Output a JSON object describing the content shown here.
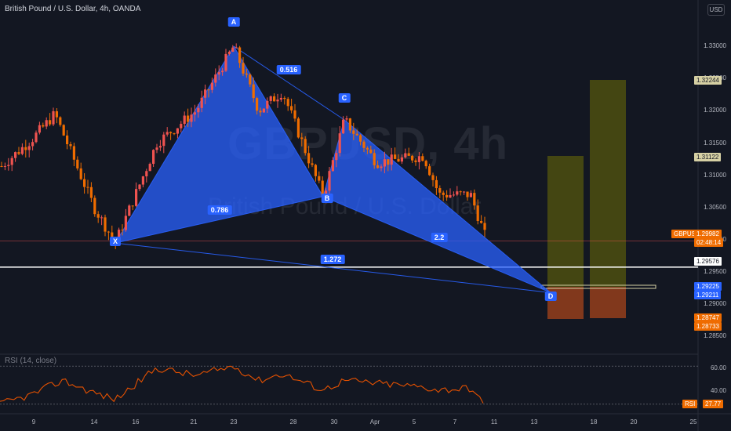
{
  "header": {
    "title": "British Pound / U.S. Dollar, 4h, OANDA",
    "currency_button": "USD"
  },
  "watermark": {
    "symbol": "GBPUSD, 4h",
    "description": "British Pound / U.S. Dollar"
  },
  "price_axis": {
    "ticks": [
      "1.33000",
      "1.32500",
      "1.32000",
      "1.31500",
      "1.31000",
      "1.30500",
      "1.30000",
      "1.29500",
      "1.29000",
      "1.28500"
    ],
    "tags": {
      "target2": "1.32244",
      "target1": "1.31122",
      "symbol_label": "GBPUSD",
      "last_price": "1.29982",
      "countdown": "02:48:14",
      "hline": "1.29576",
      "entry_a": "1.29225",
      "entry_b": "1.29211",
      "stop_a": "1.28747",
      "stop_b": "1.28733"
    }
  },
  "time_axis": {
    "labels": [
      "9",
      "14",
      "16",
      "21",
      "23",
      "28",
      "30",
      "Apr",
      "5",
      "7",
      "11",
      "13",
      "18",
      "20",
      "25"
    ]
  },
  "pattern": {
    "points": [
      "X",
      "A",
      "B",
      "C",
      "D"
    ],
    "ratios": {
      "xb": "0.786",
      "ac": "0.516",
      "bd": "2.2",
      "xd": "1.272"
    }
  },
  "rsi": {
    "title": "RSI (14, close)",
    "ticks": [
      "60.00",
      "40.00"
    ],
    "tag_label": "RSI",
    "value": "27.77"
  },
  "colors": {
    "background": "#131722",
    "bull": "#ef5350",
    "bear": "#ef6c00",
    "pattern_fill": "#2962ff",
    "rsi_line": "#e65100",
    "target_zone": "#808000",
    "stop_zone": "#b0471a"
  },
  "chart_data": {
    "type": "candlestick",
    "symbol": "GBPUSD",
    "timeframe": "4h",
    "ylim": [
      1.2825,
      1.3345
    ],
    "last_price": 1.29982,
    "harmonic_pattern": {
      "X": 1.2995,
      "A": 1.33,
      "B": 1.3067,
      "C": 1.3186,
      "D": 1.2918
    },
    "horizontal_line": 1.29576,
    "targets": [
      1.31122,
      1.32244
    ],
    "stops": [
      1.28747,
      1.28733
    ]
  }
}
